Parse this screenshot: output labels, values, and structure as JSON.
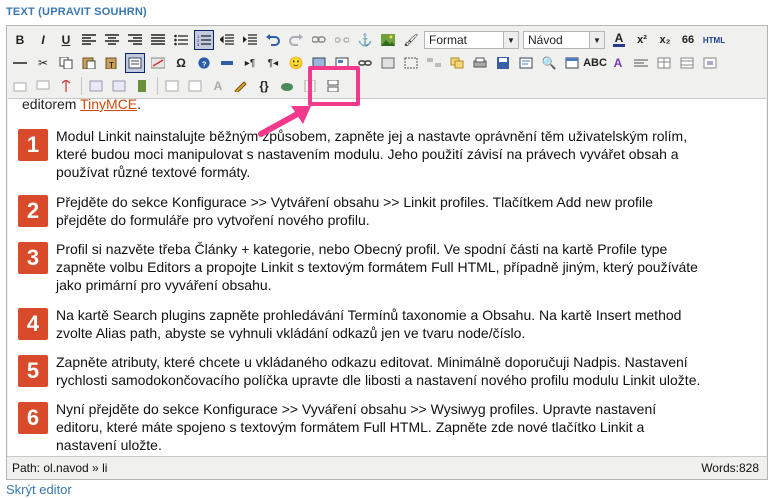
{
  "field": {
    "label": "TEXT",
    "link": "UPRAVIT SOUHRN"
  },
  "toolbar": {
    "format_select": "Format",
    "style_select": "Návod",
    "html_label": "HTML"
  },
  "intro": {
    "prefix": "editorem ",
    "link": "TinyMCE",
    "suffix": "."
  },
  "steps": [
    {
      "number": "1",
      "lines": [
        "Modul Linkit nainstalujte běžným způsobem, zapněte jej a nastavte oprávnění těm uživatelským rolím,",
        "které budou moci manipulovat s nastavením modulu. Jeho použití závisí na právech vyvářet obsah a",
        "používat různé textové formáty."
      ]
    },
    {
      "number": "2",
      "lines": [
        "Přejděte do sekce Konfigurace >> Vytváření obsahu >> Linkit profiles. Tlačítkem Add new profile",
        "přejděte do formuláře pro vytvoření nového profilu."
      ]
    },
    {
      "number": "3",
      "lines": [
        "Profil si nazvěte třeba Články + kategorie, nebo Obecný profil. Ve spodní části na kartě Profile type",
        "zapněte volbu Editors a propojte Linkit s textovým formátem Full HTML, případně jiným, který používáte",
        "jako primární pro vyváření obsahu."
      ]
    },
    {
      "number": "4",
      "lines": [
        "Na kartě Search plugins zapněte prohledávání Termínů taxonomie a Obsahu. Na kartě Insert method",
        "zvolte Alias path, abyste se vyhnuli vkládání odkazů jen ve tvaru node/číslo."
      ]
    },
    {
      "number": "5",
      "lines": [
        "Zapněte atributy, které chcete u vkládaného odkazu editovat. Minimálně doporučuji Nadpis. Nastavení",
        "rychlosti samodokončovacího políčka upravte dle libosti a nastavení nového profilu modulu Linkit uložte."
      ]
    },
    {
      "number": "6",
      "lines": [
        "Nyní přejděte do sekce Konfigurace >> Vyváření obsahu >> Wysiwyg profiles. Upravte nastavení",
        "editoru, které máte spojeno s textovým formátem Full HTML. Zapněte zde nové tlačítko Linkit a",
        "nastavení uložte."
      ]
    }
  ],
  "status": {
    "path": "Path: ol.navod » li",
    "words": "Words:828"
  },
  "footer": {
    "hide_editor": "Skrýt editor"
  },
  "colors": {
    "accent": "#3a76b0",
    "step_badge": "#d94a2a",
    "highlight": "#f2398b",
    "link": "#d2480b"
  }
}
